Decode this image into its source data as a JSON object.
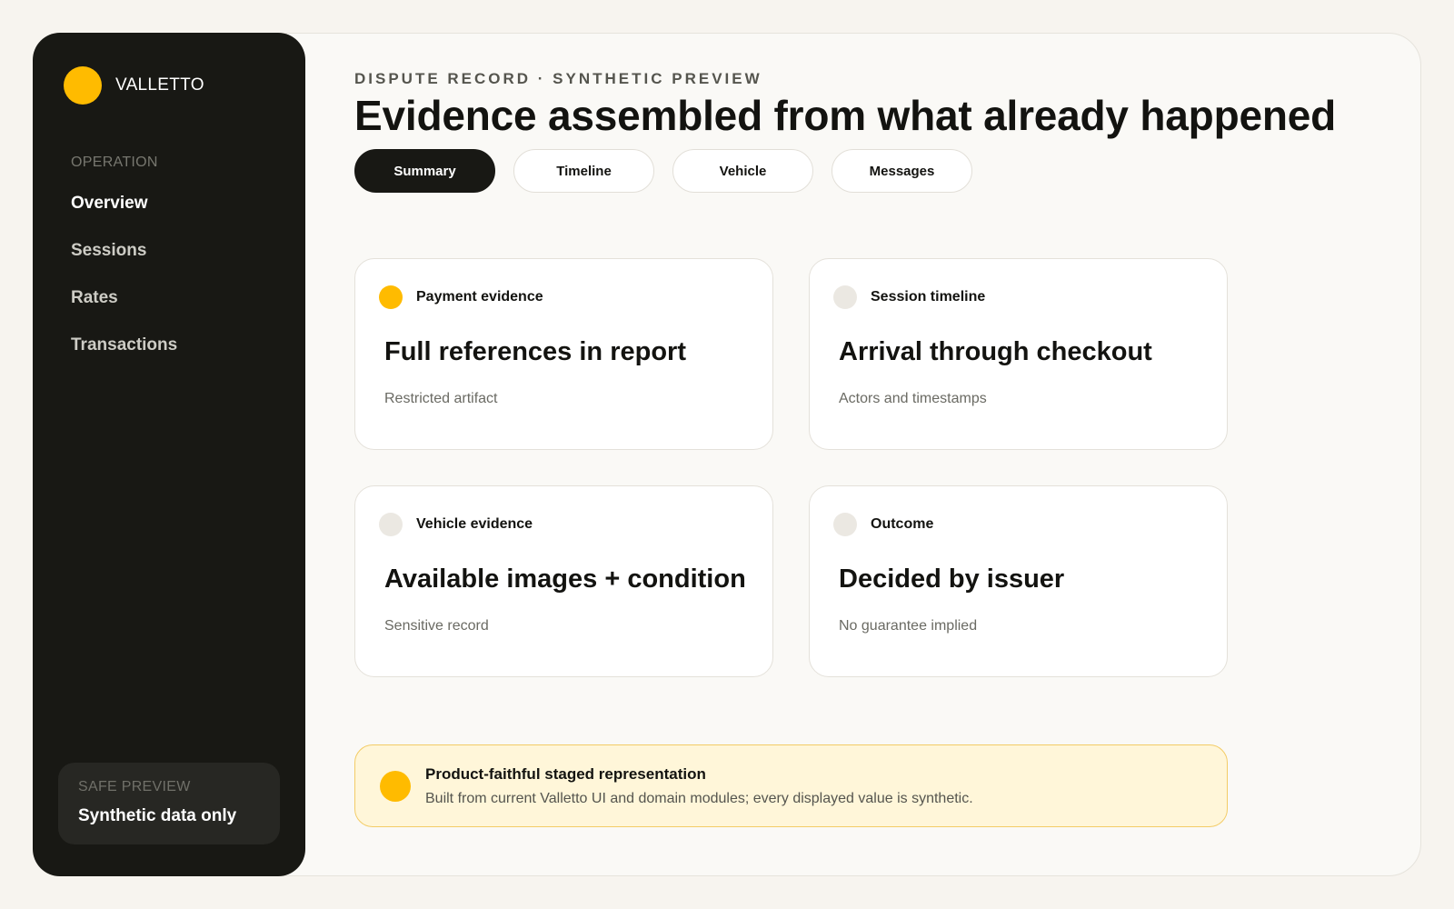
{
  "brand": {
    "name": "VALLETTO",
    "accent_color": "#ffbb00"
  },
  "sidebar": {
    "section_label": "OPERATION",
    "items": [
      {
        "label": "Overview",
        "active": true
      },
      {
        "label": "Sessions",
        "active": false
      },
      {
        "label": "Rates",
        "active": false
      },
      {
        "label": "Transactions",
        "active": false
      }
    ],
    "footer": {
      "label": "SAFE PREVIEW",
      "value": "Synthetic data only"
    }
  },
  "header": {
    "eyebrow": "DISPUTE RECORD · SYNTHETIC PREVIEW",
    "title": "Evidence assembled from what already happened"
  },
  "tabs": [
    {
      "label": "Summary",
      "active": true
    },
    {
      "label": "Timeline",
      "active": false
    },
    {
      "label": "Vehicle",
      "active": false
    },
    {
      "label": "Messages",
      "active": false
    }
  ],
  "cards": [
    {
      "label": "Payment evidence",
      "title": "Full references in report",
      "subtitle": "Restricted artifact",
      "highlighted": true
    },
    {
      "label": "Session timeline",
      "title": "Arrival through checkout",
      "subtitle": "Actors and timestamps",
      "highlighted": false
    },
    {
      "label": "Vehicle evidence",
      "title": "Available images + condition",
      "subtitle": "Sensitive record",
      "highlighted": false
    },
    {
      "label": "Outcome",
      "title": "Decided by issuer",
      "subtitle": "No guarantee implied",
      "highlighted": false
    }
  ],
  "notice": {
    "title": "Product-faithful staged representation",
    "body": "Built from current Valletto UI and domain modules; every displayed value is synthetic."
  }
}
